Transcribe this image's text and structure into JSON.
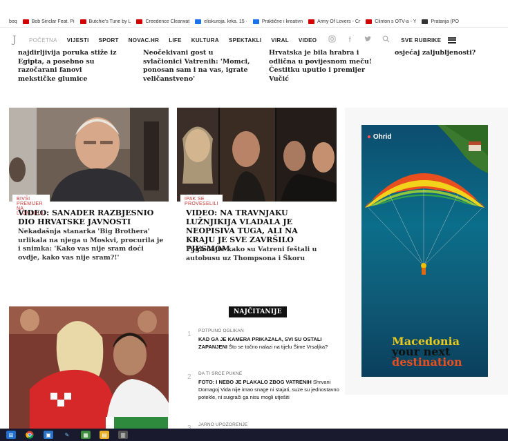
{
  "bookmarks": [
    {
      "label": "boq",
      "color": "#ffffff"
    },
    {
      "label": "Bob Sinclar Feat. Pi",
      "color": "#d40000"
    },
    {
      "label": "Butchie's Tune by L",
      "color": "#d40000"
    },
    {
      "label": "Creedence Clearwat",
      "color": "#d40000"
    },
    {
      "label": "eliskuroja. krka. 15 ·",
      "color": "#1a73e8"
    },
    {
      "label": "Praktične i kreativn",
      "color": "#1a73e8"
    },
    {
      "label": "Army Of Lovers - Cr",
      "color": "#d40000"
    },
    {
      "label": "Clinton s OTV-a - Y",
      "color": "#d40000"
    },
    {
      "label": "Pratanja (PO",
      "color": "#333333"
    }
  ],
  "nav": {
    "home": "POČETNA",
    "items": [
      "VIJESTI",
      "SPORT",
      "NOVAC.HR",
      "LIFE",
      "KULTURA",
      "SPEKTAKLI",
      "VIRAL",
      "VIDEO"
    ],
    "all_sections": "SVE RUBRIKE"
  },
  "snippets": [
    "najdirljivija poruka stiže iz Egipta, a posebno su razočarani fanovi mekstičke glumice",
    "Neočekivani gost u svlačionici Vatrenih: 'Momci, ponosan sam i na vas, igrate veličanstveno'",
    "Hrvatska je bila hrabra i odlična u povijesnom meču! Čestitku uputio i premijer Vučić",
    "osjećaj zaljubljenosti?"
  ],
  "cards": [
    {
      "kicker": "BIVŠI PREMIJER NA LUŽNJIKIJU",
      "headline": "VIDEO: SANADER RAZBJESNIO DIO HRVATSKE JAVNOSTI",
      "sub": "Nekadašnja stanarka 'Big Brothera' urlikala na njega u Moskvi, procurila je i snimka: 'Kako vas nije sram doći ovdje, kako vas nije sram?!'"
    },
    {
      "kicker": "IPAK SE PROVESELILI",
      "headline": "VIDEO: NA TRAVNJAKU LUŽNJIKIJA VLADALA JE NEOPISIVA TUGA, ALI NA KRAJU JE SVE ZAVRŠILO PJESMOM",
      "sub": "Pogledajte kako su Vatreni feštali u autobusu uz Thompsona i Škoru"
    }
  ],
  "ad": {
    "location": "Ohrid",
    "brand_1": "Macedonia",
    "brand_2": "your next",
    "brand_3": "destination"
  },
  "most_read": {
    "title": "NAJČITANIJE",
    "items": [
      {
        "num": "1",
        "kicker": "POTPUNO OGLIKAN",
        "title": "KAD GA JE KAMERA PRIKAZALA, SVI SU OSTALI ZAPANJENI",
        "rest": "Što se točno nalazi na tijelu Šime Vrsaljka?"
      },
      {
        "num": "2",
        "kicker": "DA TI SRCE PUKNE",
        "title": "FOTO: I NEBO JE PLAKALO ZBOG VATRENIH",
        "rest": "Shrvani Domagoj Vida nije imao snage ni stajati, suze su jednostavno potekle, ni suigrači ga nisu mogli utješiti"
      },
      {
        "num": "3",
        "kicker": "JARNO UPOZORENJE",
        "title": "",
        "rest": ""
      }
    ]
  },
  "colors": {
    "accent": "#cc3333",
    "taskbar": "#1a1a2e"
  }
}
